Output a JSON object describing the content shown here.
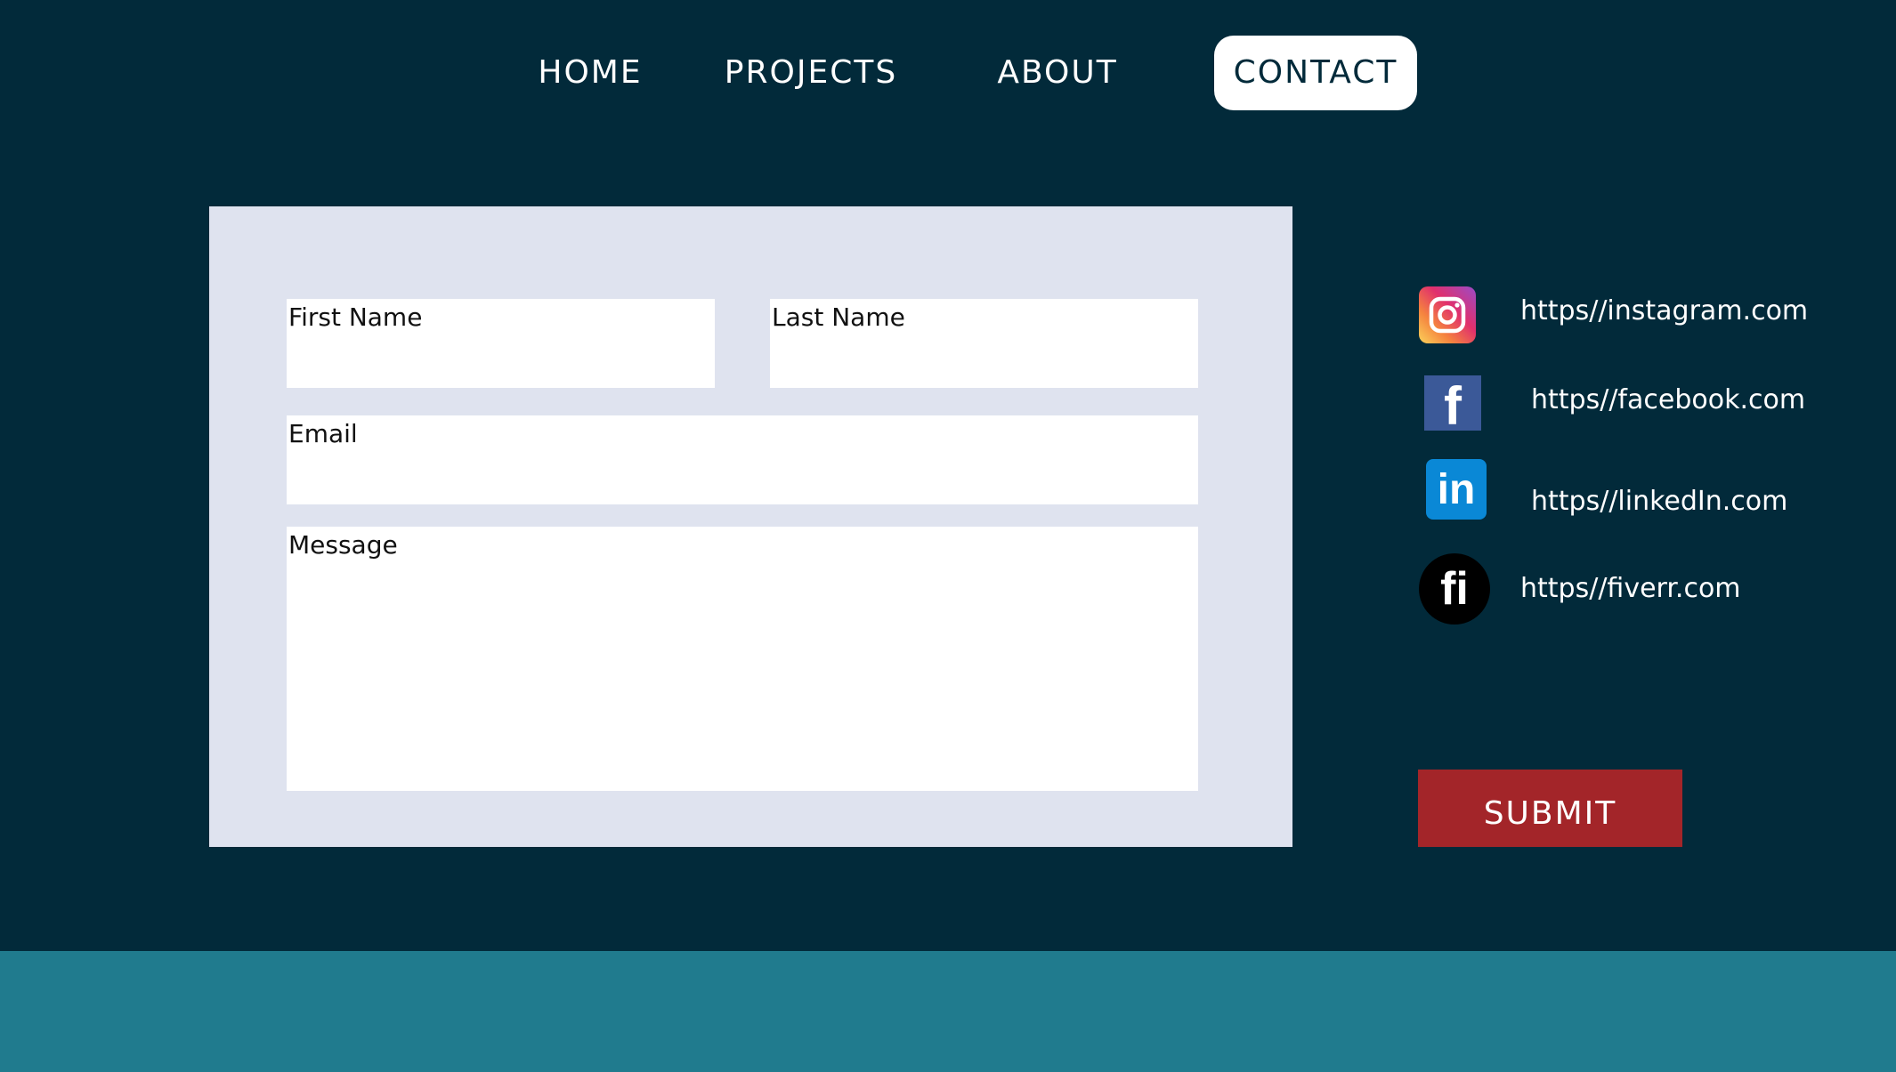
{
  "nav": {
    "items": [
      {
        "label": "HOME"
      },
      {
        "label": "PROJECTS"
      },
      {
        "label": "ABOUT"
      },
      {
        "label": "CONTACT",
        "active": true
      }
    ]
  },
  "form": {
    "first_name_label": "First Name",
    "last_name_label": "Last Name",
    "email_label": "Email",
    "message_label": "Message"
  },
  "social": {
    "instagram": {
      "icon": "instagram-icon",
      "link": "https//instagram.com"
    },
    "facebook": {
      "icon": "facebook-icon",
      "link": "https//facebook.com"
    },
    "linkedin": {
      "icon": "linkedin-icon",
      "link": "https//linkedIn.com"
    },
    "fiverr": {
      "icon": "fiverr-icon",
      "link": "https//fiverr.com"
    }
  },
  "submit_label": "SUBMIT",
  "colors": {
    "background": "#022a3a",
    "footer": "#207b8e",
    "panel": "#dfe3ef",
    "submit": "#a32529"
  }
}
